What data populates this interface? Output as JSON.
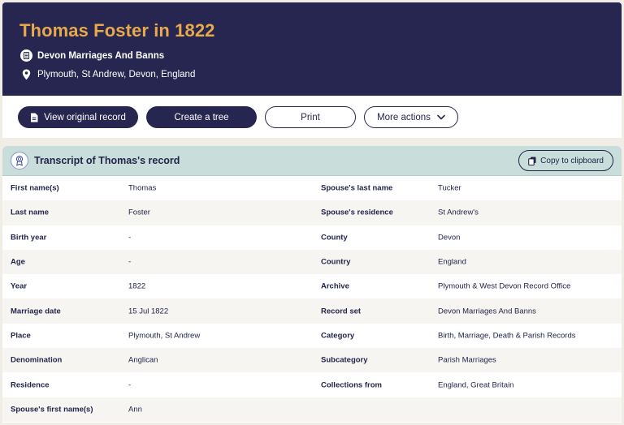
{
  "header": {
    "title": "Thomas Foster in 1822",
    "collection": "Devon Marriages And Banns",
    "collection_icon": "document-icon",
    "place": "Plymouth, St Andrew, Devon, England",
    "place_icon": "map-pin-icon"
  },
  "actions": {
    "view_original": "View original record",
    "create_tree": "Create a tree",
    "print": "Print",
    "more_actions": "More actions"
  },
  "transcript": {
    "title": "Transcript of Thomas's record",
    "copy_label": "Copy to clipboard",
    "rows": [
      {
        "l1": "First name(s)",
        "v1": "Thomas",
        "l2": "Spouse's last name",
        "v2": "Tucker"
      },
      {
        "l1": "Last name",
        "v1": "Foster",
        "l2": "Spouse's residence",
        "v2": "St Andrew's"
      },
      {
        "l1": "Birth year",
        "v1": "-",
        "l2": "County",
        "v2": "Devon"
      },
      {
        "l1": "Age",
        "v1": "-",
        "l2": "Country",
        "v2": "England"
      },
      {
        "l1": "Year",
        "v1": "1822",
        "l2": "Archive",
        "v2": "Plymouth & West Devon Record Office"
      },
      {
        "l1": "Marriage date",
        "v1": "15 Jul 1822",
        "l2": "Record set",
        "v2": "Devon Marriages And Banns"
      },
      {
        "l1": "Place",
        "v1": "Plymouth, St Andrew",
        "l2": "Category",
        "v2": "Birth, Marriage, Death & Parish Records"
      },
      {
        "l1": "Denomination",
        "v1": "Anglican",
        "l2": "Subcategory",
        "v2": "Parish Marriages"
      },
      {
        "l1": "Residence",
        "v1": "-",
        "l2": "Collections from",
        "v2": "England, Great Britain"
      },
      {
        "l1": "Spouse's first name(s)",
        "v1": "Ann",
        "l2": "",
        "v2": ""
      }
    ]
  },
  "colors": {
    "header_bg": "#262650",
    "title_accent": "#e7a94a",
    "transcript_header_bg": "#c9dedb"
  }
}
